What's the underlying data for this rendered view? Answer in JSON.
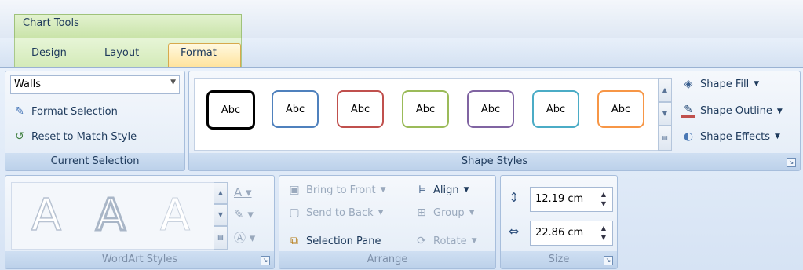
{
  "context_tab": {
    "label": "Chart Tools"
  },
  "tabs": [
    "Design",
    "Layout",
    "Format"
  ],
  "current_selection": {
    "dropdown_value": "Walls",
    "format_selection": "Format Selection",
    "reset_style": "Reset to Match Style",
    "group_label": "Current Selection"
  },
  "shape_styles": {
    "swatch_text": "Abc",
    "swatch_colors": [
      "#000000",
      "#4f81bd",
      "#c0504d",
      "#9bbb59",
      "#8064a2",
      "#4bacc6",
      "#f79646"
    ],
    "shape_fill": "Shape Fill",
    "shape_outline": "Shape Outline",
    "shape_effects": "Shape Effects",
    "group_label": "Shape Styles"
  },
  "wordart": {
    "letter": "A",
    "group_label": "WordArt Styles"
  },
  "arrange": {
    "bring_to_front": "Bring to Front",
    "send_to_back": "Send to Back",
    "selection_pane": "Selection Pane",
    "align": "Align",
    "group": "Group",
    "rotate": "Rotate",
    "group_label": "Arrange"
  },
  "size": {
    "height": "12.19 cm",
    "width": "22.86 cm",
    "group_label": "Size"
  }
}
